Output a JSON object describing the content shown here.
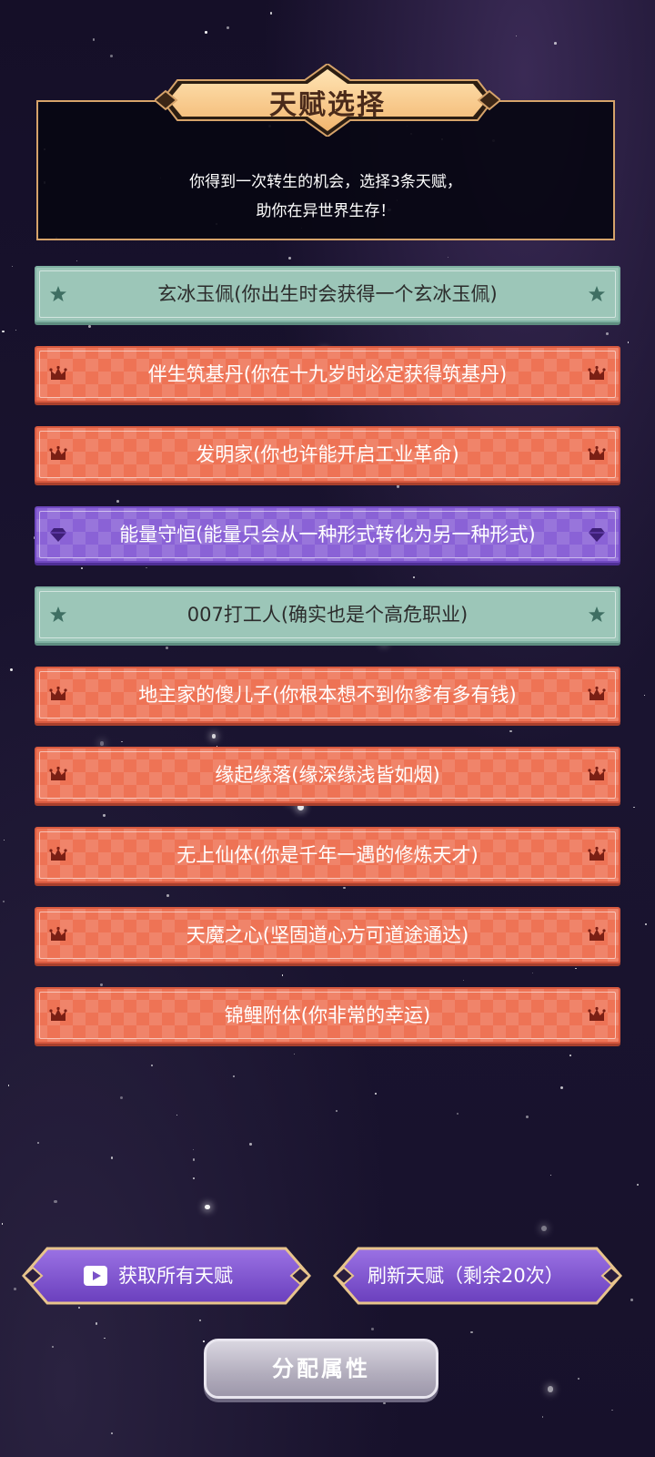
{
  "header": {
    "title": "天赋选择",
    "description_line1": "你得到一次转生的机会，选择3条天赋，",
    "description_line2": "助你在异世界生存！"
  },
  "talents": [
    {
      "label": "玄冰玉佩(你出生时会获得一个玄冰玉佩)",
      "rarity": "teal",
      "icon": "star-icon"
    },
    {
      "label": "伴生筑基丹(你在十九岁时必定获得筑基丹)",
      "rarity": "orange",
      "icon": "crown-icon"
    },
    {
      "label": "发明家(你也许能开启工业革命)",
      "rarity": "orange",
      "icon": "crown-icon"
    },
    {
      "label": "能量守恒(能量只会从一种形式转化为另一种形式)",
      "rarity": "purple",
      "icon": "diamond-icon"
    },
    {
      "label": "007打工人(确实也是个高危职业)",
      "rarity": "teal",
      "icon": "star-icon"
    },
    {
      "label": "地主家的傻儿子(你根本想不到你爹有多有钱)",
      "rarity": "orange",
      "icon": "crown-icon"
    },
    {
      "label": "缘起缘落(缘深缘浅皆如烟)",
      "rarity": "orange",
      "icon": "crown-icon"
    },
    {
      "label": "无上仙体(你是千年一遇的修炼天才)",
      "rarity": "orange",
      "icon": "crown-icon"
    },
    {
      "label": "天魔之心(坚固道心方可道途通达)",
      "rarity": "orange",
      "icon": "crown-icon"
    },
    {
      "label": "锦鲤附体(你非常的幸运)",
      "rarity": "orange",
      "icon": "crown-icon"
    }
  ],
  "buttons": {
    "get_all": "获取所有天赋",
    "refresh": "刷新天赋（剩余20次）",
    "assign": "分配属性"
  },
  "colors": {
    "teal": "#9cc6b8",
    "orange": "#ee7355",
    "purple": "#8a62d6",
    "gold_border": "#d6a36a"
  }
}
